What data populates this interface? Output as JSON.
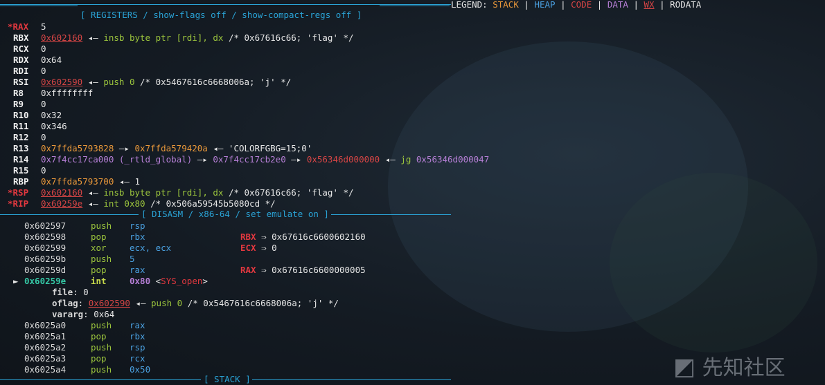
{
  "legend": {
    "prefix": "LEGEND:",
    "items": [
      {
        "label": "STACK",
        "color": "#e8973a",
        "underline": false
      },
      {
        "label": "HEAP",
        "color": "#4aa0e0",
        "underline": false
      },
      {
        "label": "CODE",
        "color": "#d64545",
        "underline": false
      },
      {
        "label": "DATA",
        "color": "#b67fd6",
        "underline": false
      },
      {
        "label": "WX",
        "color": "#d64545",
        "underline": true
      },
      {
        "label": "RODATA",
        "color": "#e6e6e6",
        "underline": false
      }
    ],
    "separator": "|"
  },
  "registers_header": "[ REGISTERS / show-flags off / show-compact-regs off ]",
  "disasm_header": "[ DISASM / x86-64 / set emulate on ]",
  "stack_header": "[ STACK ]",
  "registers": [
    {
      "name": "*RAX",
      "changed": true,
      "parts": [
        {
          "t": "5",
          "c": "white"
        }
      ]
    },
    {
      "name": "RBX",
      "changed": false,
      "parts": [
        {
          "t": "0x602160",
          "c": "red-ul"
        },
        {
          "t": " ◂— ",
          "c": "white"
        },
        {
          "t": "insb byte ptr [rdi], dx",
          "c": "green"
        },
        {
          "t": " /* 0x67616c66; 'flag' */",
          "c": "white"
        }
      ]
    },
    {
      "name": "RCX",
      "changed": false,
      "parts": [
        {
          "t": "0",
          "c": "white"
        }
      ]
    },
    {
      "name": "RDX",
      "changed": false,
      "parts": [
        {
          "t": "0x64",
          "c": "white"
        }
      ]
    },
    {
      "name": "RDI",
      "changed": false,
      "parts": [
        {
          "t": "0",
          "c": "white"
        }
      ]
    },
    {
      "name": "RSI",
      "changed": false,
      "parts": [
        {
          "t": "0x602590",
          "c": "red-ul"
        },
        {
          "t": " ◂— ",
          "c": "white"
        },
        {
          "t": "push 0",
          "c": "green"
        },
        {
          "t": " /* 0x5467616c6668006a; 'j' */",
          "c": "white"
        }
      ]
    },
    {
      "name": "R8",
      "changed": false,
      "parts": [
        {
          "t": "0xffffffff",
          "c": "white"
        }
      ]
    },
    {
      "name": "R9",
      "changed": false,
      "parts": [
        {
          "t": "0",
          "c": "white"
        }
      ]
    },
    {
      "name": "R10",
      "changed": false,
      "parts": [
        {
          "t": "0x32",
          "c": "white"
        }
      ]
    },
    {
      "name": "R11",
      "changed": false,
      "parts": [
        {
          "t": "0x346",
          "c": "white"
        }
      ]
    },
    {
      "name": "R12",
      "changed": false,
      "parts": [
        {
          "t": "0",
          "c": "white"
        }
      ]
    },
    {
      "name": "R13",
      "changed": false,
      "parts": [
        {
          "t": "0x7ffda5793828",
          "c": "orange"
        },
        {
          "t": " —▸ ",
          "c": "white"
        },
        {
          "t": "0x7ffda579420a",
          "c": "orange"
        },
        {
          "t": " ◂— 'COLORFGBG=15;0'",
          "c": "white"
        }
      ]
    },
    {
      "name": "R14",
      "changed": false,
      "parts": [
        {
          "t": "0x7f4cc17ca000 (_rtld_global)",
          "c": "purple"
        },
        {
          "t": " —▸ ",
          "c": "white"
        },
        {
          "t": "0x7f4cc17cb2e0",
          "c": "purple"
        },
        {
          "t": " —▸ ",
          "c": "white"
        },
        {
          "t": "0x56346d000000",
          "c": "red-plain"
        },
        {
          "t": " ◂— ",
          "c": "white"
        },
        {
          "t": "jg ",
          "c": "green"
        },
        {
          "t": "0x56346d000047",
          "c": "purple"
        }
      ]
    },
    {
      "name": "R15",
      "changed": false,
      "parts": [
        {
          "t": "0",
          "c": "white"
        }
      ]
    },
    {
      "name": "RBP",
      "changed": false,
      "parts": [
        {
          "t": "0x7ffda5793700",
          "c": "orange"
        },
        {
          "t": " ◂— 1",
          "c": "white"
        }
      ]
    },
    {
      "name": "*RSP",
      "changed": true,
      "parts": [
        {
          "t": "0x602160",
          "c": "red-ul"
        },
        {
          "t": " ◂— ",
          "c": "white"
        },
        {
          "t": "insb byte ptr [rdi], dx",
          "c": "green"
        },
        {
          "t": " /* 0x67616c66; 'flag' */",
          "c": "white"
        }
      ]
    },
    {
      "name": "*RIP",
      "changed": true,
      "parts": [
        {
          "t": "0x60259e",
          "c": "red-ul"
        },
        {
          "t": " ◂— ",
          "c": "white"
        },
        {
          "t": "int 0x80",
          "c": "green"
        },
        {
          "t": " /* 0x506a59545b5080cd */",
          "c": "white"
        }
      ]
    }
  ],
  "disasm": [
    {
      "addr": "0x602597",
      "op": "push",
      "args": "rsp",
      "ann_reg": "",
      "ann_val": ""
    },
    {
      "addr": "0x602598",
      "op": "pop",
      "args": "rbx",
      "ann_reg": "RBX",
      "ann_val": " ⇒ 0x67616c6600602160"
    },
    {
      "addr": "0x602599",
      "op": "xor",
      "args": "ecx, ecx",
      "ann_reg": "ECX",
      "ann_val": " ⇒ 0"
    },
    {
      "addr": "0x60259b",
      "op": "push",
      "args": "5",
      "ann_reg": "",
      "ann_val": ""
    },
    {
      "addr": "0x60259d",
      "op": "pop",
      "args": "rax",
      "ann_reg": "RAX",
      "ann_val": " ⇒ 0x67616c6600000005"
    },
    {
      "addr": "0x60259e",
      "op": "int",
      "args": "0x80",
      "ann_reg": "",
      "ann_val": "",
      "current": true,
      "marker": "►",
      "syscall": "<SYS_open>"
    }
  ],
  "syscall_args": [
    {
      "name": "file",
      "value": ": 0"
    },
    {
      "name": "oflag",
      "value": ": ",
      "addr": "0x602590",
      "rest_prefix": " ◂— ",
      "rest_code": "push 0",
      "rest": " /* 0x5467616c6668006a; 'j' */"
    },
    {
      "name": "vararg",
      "value": ": 0x64"
    }
  ],
  "disasm_after": [
    {
      "addr": "0x6025a0",
      "op": "push",
      "args": "rax"
    },
    {
      "addr": "0x6025a1",
      "op": "pop",
      "args": "rbx"
    },
    {
      "addr": "0x6025a2",
      "op": "push",
      "args": "rsp"
    },
    {
      "addr": "0x6025a3",
      "op": "pop",
      "args": "rcx"
    },
    {
      "addr": "0x6025a4",
      "op": "push",
      "args": "0x50"
    }
  ],
  "watermark": "先知社区"
}
